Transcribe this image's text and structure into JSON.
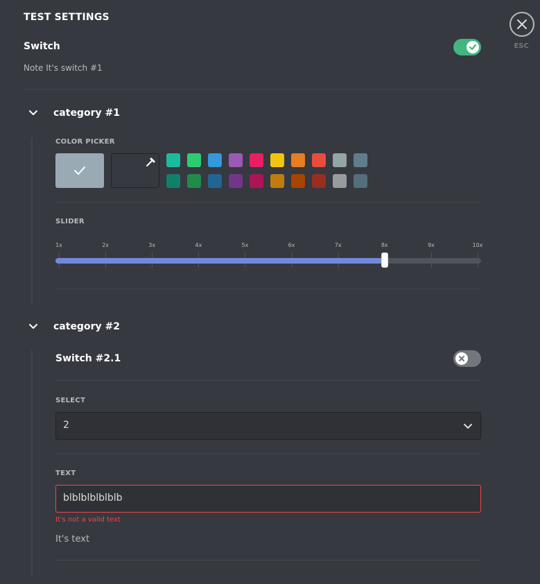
{
  "header": {
    "title": "TEST SETTINGS",
    "esc_label": "ESC"
  },
  "switch": {
    "label": "Switch",
    "note": "Note It's switch #1",
    "on": true
  },
  "category1": {
    "title": "category #1",
    "color_picker": {
      "label": "COLOR PICKER",
      "selected": "#99aab5",
      "default": "#99aab5",
      "colors_row1": [
        "#1abc9c",
        "#2ecc71",
        "#3498db",
        "#9b59b6",
        "#e91e63",
        "#f1c40f",
        "#e67e22",
        "#e74c3c",
        "#95a5a6",
        "#607d8b"
      ],
      "colors_row2": [
        "#11806a",
        "#1f8b4c",
        "#206694",
        "#71368a",
        "#ad1457",
        "#c27c0e",
        "#a84300",
        "#992d22",
        "#979c9f",
        "#546e7a"
      ]
    },
    "slider": {
      "label": "SLIDER",
      "ticks": [
        "1x",
        "2x",
        "3x",
        "4x",
        "5x",
        "6x",
        "7x",
        "8x",
        "9x",
        "10x"
      ],
      "value": "8x",
      "fill_color": "#7289da"
    }
  },
  "category2": {
    "title": "category #2",
    "switch": {
      "label": "Switch #2.1",
      "on": false
    },
    "select": {
      "label": "SELECT",
      "value": "2"
    },
    "text": {
      "label": "TEXT",
      "value": "blblblblblblb",
      "error": "It's not a valid text",
      "note": "It's text"
    }
  },
  "colors": {
    "background": "#36393f",
    "accent": "#7289da",
    "success": "#43b581",
    "error": "#f04747"
  }
}
